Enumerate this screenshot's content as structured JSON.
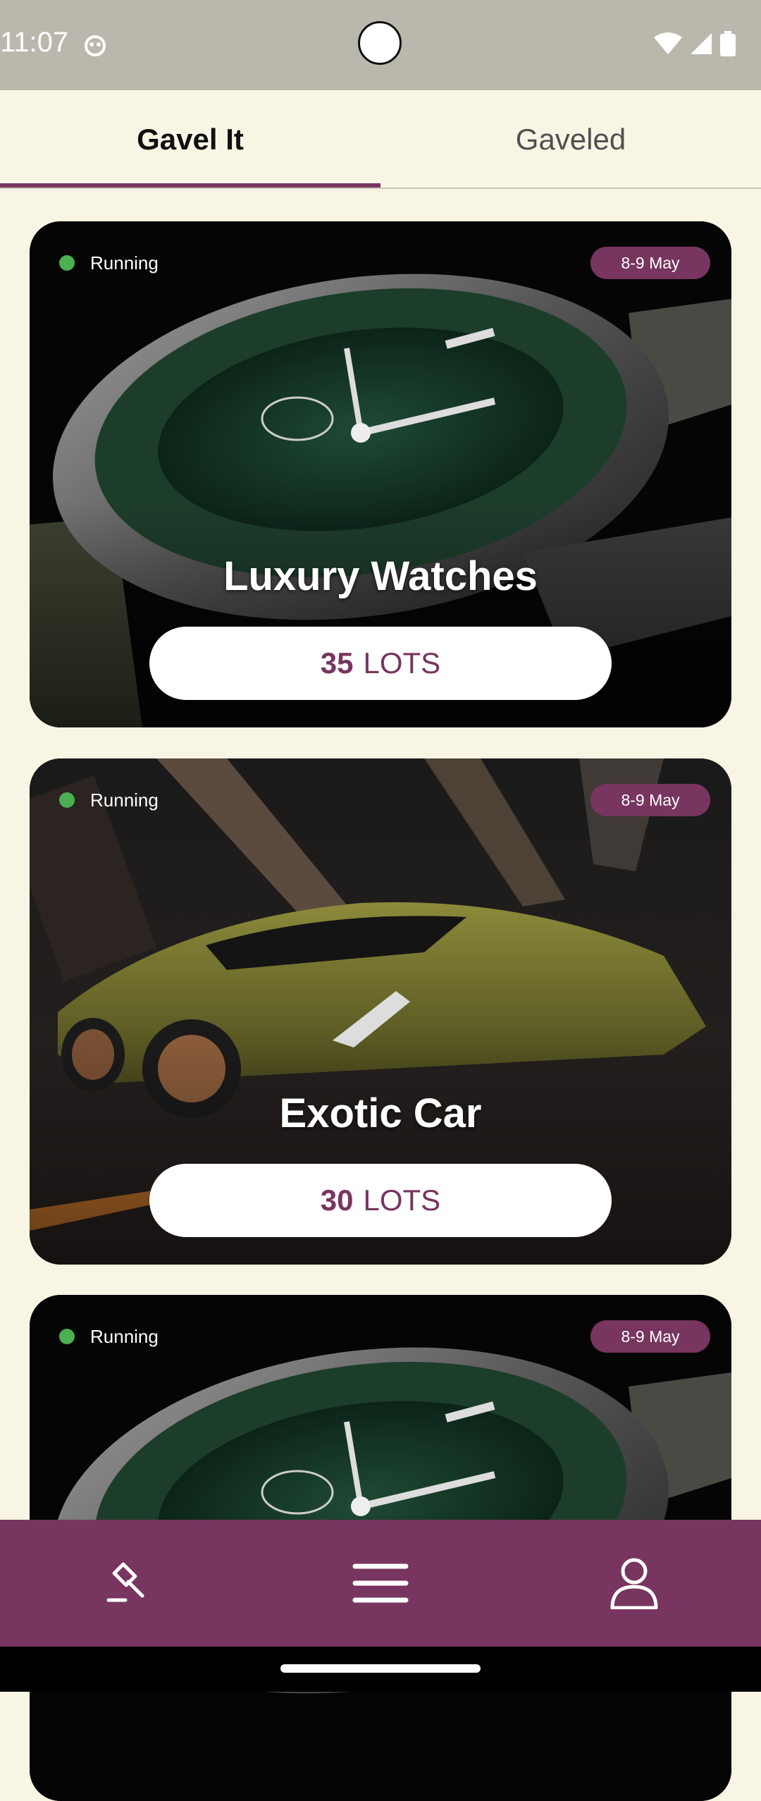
{
  "status_bar": {
    "time": "11:07",
    "icons": [
      "app-notification-icon",
      "wifi-icon",
      "cellular-signal-icon",
      "battery-icon"
    ]
  },
  "tabs": [
    {
      "label": "Gavel It",
      "active": true
    },
    {
      "label": "Gaveled",
      "active": false
    }
  ],
  "cards": [
    {
      "status": "Running",
      "date": "8-9 May",
      "title": "Luxury Watches",
      "lots_count": "35",
      "lots_label": "LOTS",
      "image": "watch"
    },
    {
      "status": "Running",
      "date": "8-9 May",
      "title": "Exotic Car",
      "lots_count": "30",
      "lots_label": "LOTS",
      "image": "car"
    },
    {
      "status": "Running",
      "date": "8-9 May",
      "title": "",
      "lots_count": "",
      "lots_label": "",
      "image": "watch"
    }
  ],
  "bottom_nav": {
    "items": [
      "gavel-icon",
      "menu-icon",
      "profile-icon"
    ]
  },
  "colors": {
    "accent": "#77355f",
    "background": "#f8f5e4",
    "status_bar": "#bab8ad",
    "running": "#4caf50"
  }
}
